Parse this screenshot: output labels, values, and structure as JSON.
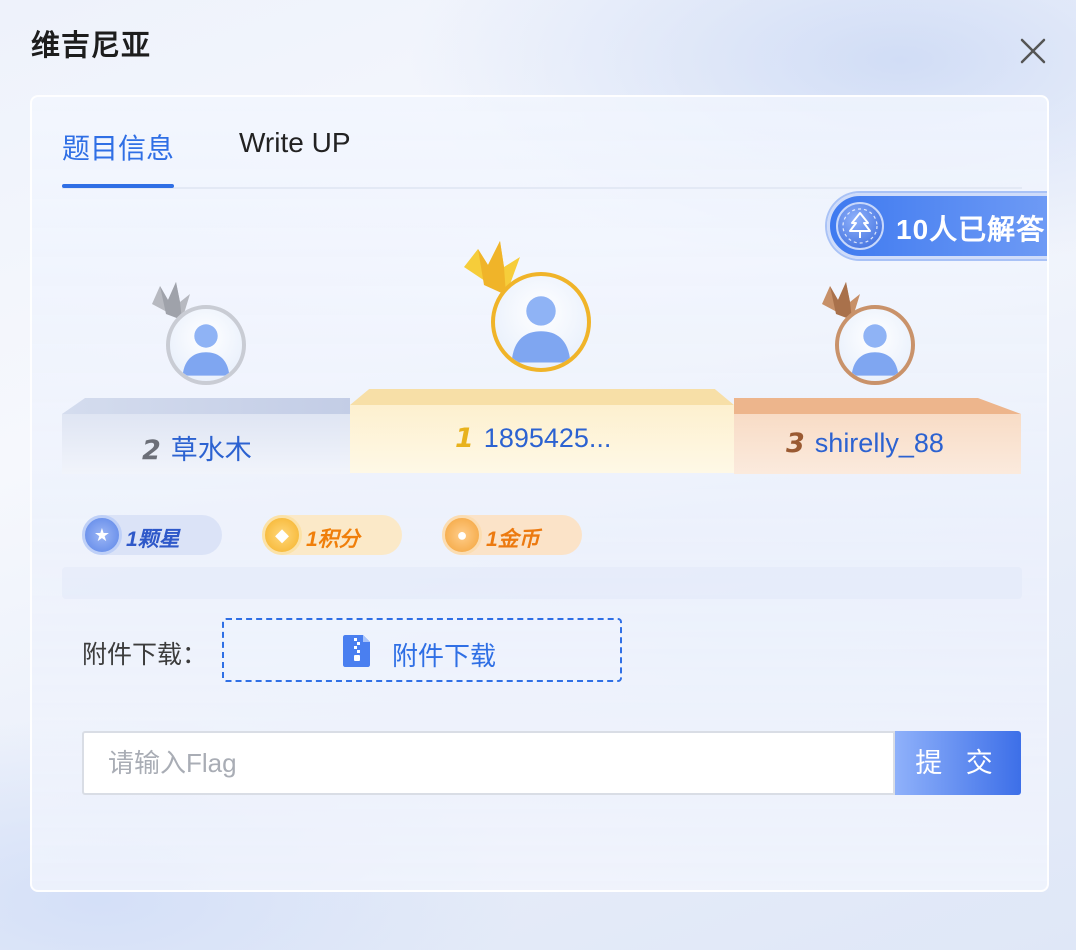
{
  "dialog": {
    "title": "维吉尼亚",
    "close_icon": "close-icon"
  },
  "tabs": [
    {
      "label": "题目信息",
      "active": true
    },
    {
      "label": "Write UP",
      "active": false
    }
  ],
  "solved": {
    "text": "10人已解答",
    "icon": "tree-icon"
  },
  "podium": {
    "first": {
      "rank": "1",
      "name": "1895425..."
    },
    "second": {
      "rank": "2",
      "name": "草水木"
    },
    "third": {
      "rank": "3",
      "name": "shirelly_88"
    }
  },
  "rewards": [
    {
      "text": "1颗星",
      "icon": "star-icon",
      "color": "#2e58c9"
    },
    {
      "text": "1积分",
      "icon": "points-coin-icon",
      "color": "#f07f0a"
    },
    {
      "text": "1金币",
      "icon": "money-bag-icon",
      "color": "#ec7a10"
    }
  ],
  "attachment": {
    "label": "附件下载：",
    "button_label": "附件下载",
    "icon": "zip-file-icon"
  },
  "flag": {
    "placeholder": "请输入Flag",
    "value": "",
    "submit_label": "提 交"
  },
  "colors": {
    "accent": "#2f6fe5",
    "gold": "#f0b429",
    "silver": "#c9ccd4",
    "bronze": "#c9926a"
  }
}
